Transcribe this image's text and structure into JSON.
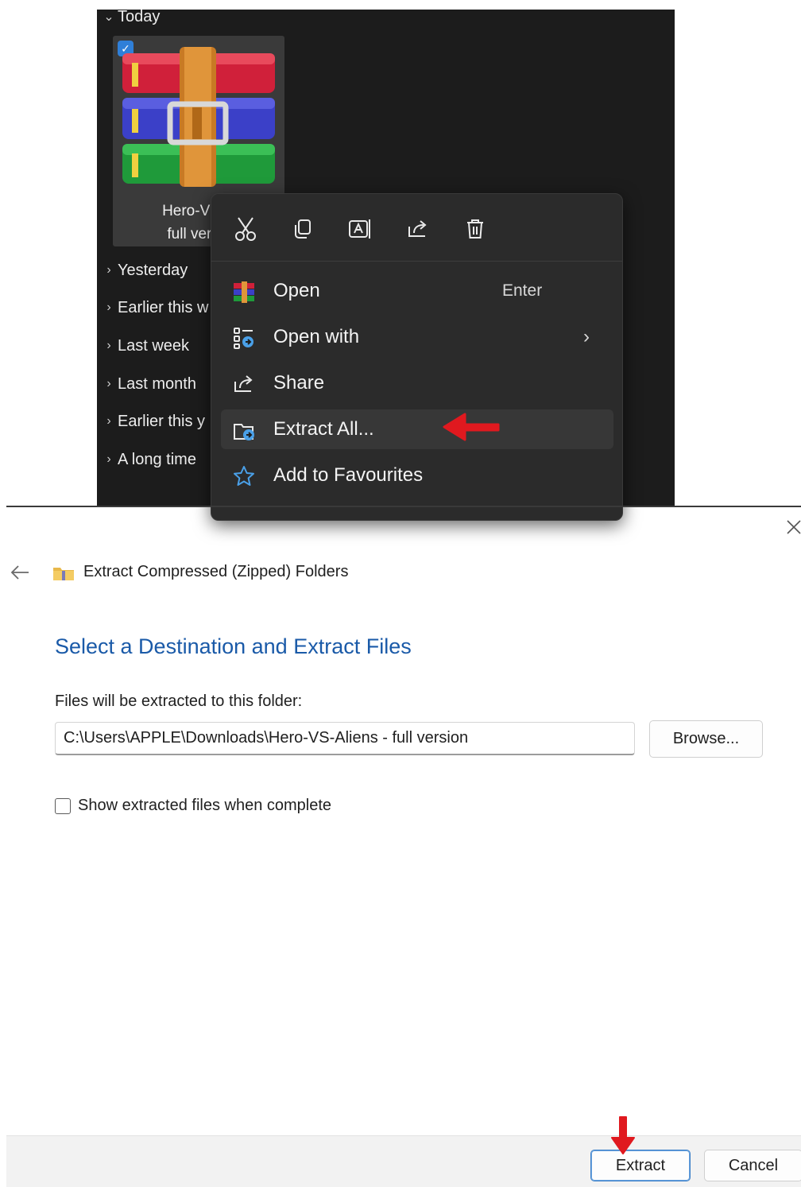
{
  "explorer": {
    "groups": [
      {
        "label": "Today",
        "expanded": true
      },
      {
        "label": "Yesterday",
        "expanded": false
      },
      {
        "label": "Earlier this w",
        "expanded": false
      },
      {
        "label": "Last week",
        "expanded": false
      },
      {
        "label": "Last month",
        "expanded": false
      },
      {
        "label": "Earlier this y",
        "expanded": false
      },
      {
        "label": "A long time",
        "expanded": false
      }
    ],
    "file": {
      "name_line1": "Hero-VS-A",
      "name_line2": "full versic",
      "icon": "winrar-archive-icon",
      "selected": true
    }
  },
  "context_menu": {
    "toolbar_icons": [
      "cut-icon",
      "copy-icon",
      "rename-icon",
      "share-icon",
      "delete-icon"
    ],
    "items": [
      {
        "label": "Open",
        "shortcut": "Enter",
        "icon": "winrar-icon"
      },
      {
        "label": "Open with",
        "icon": "open-with-icon",
        "has_submenu": true
      },
      {
        "label": "Share",
        "icon": "share-icon"
      },
      {
        "label": "Extract All...",
        "icon": "extract-icon",
        "highlighted": true
      },
      {
        "label": "Add to Favourites",
        "icon": "star-icon"
      }
    ]
  },
  "dialog": {
    "title": "Extract Compressed (Zipped) Folders",
    "heading": "Select a Destination and Extract Files",
    "destination_label": "Files will be extracted to this folder:",
    "destination_path": "C:\\Users\\APPLE\\Downloads\\Hero-VS-Aliens - full version",
    "browse_label": "Browse...",
    "show_files_label": "Show extracted files when complete",
    "show_files_checked": false,
    "extract_label": "Extract",
    "cancel_label": "Cancel"
  },
  "colors": {
    "explorer_bg": "#1c1c1c",
    "menu_bg": "#2b2b2b",
    "heading_blue": "#1a5aa8",
    "accent_blue": "#2f7fd8",
    "annotation_red": "#e0191f"
  }
}
